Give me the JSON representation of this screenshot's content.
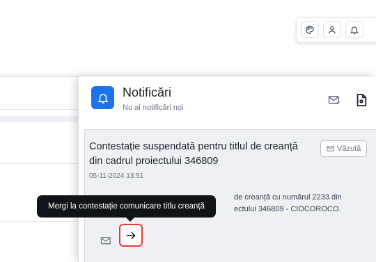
{
  "toolbar": {
    "icons": [
      "palette-icon",
      "user-icon",
      "bell-icon"
    ]
  },
  "notifications": {
    "title": "Notificări",
    "subtitle": "Nu ai notificări noi",
    "header_icons": [
      "mail-check-icon",
      "document-icon"
    ],
    "item": {
      "title": "Contestație suspendată pentru titlul de creanță din cadrul proiectului 346809",
      "date": "05-11-2024 13:51",
      "seen_label": "Văzută",
      "body_line1": "de creanță cu numărul 2233 din",
      "body_line2": "ectului 346809 - CIOCOROCO."
    }
  },
  "tooltip": {
    "text": "Mergi la contestație comunicare titlu creanță"
  },
  "colors": {
    "accent": "#1a73e8",
    "highlight_border": "#e53935",
    "tooltip_bg": "#101418"
  }
}
